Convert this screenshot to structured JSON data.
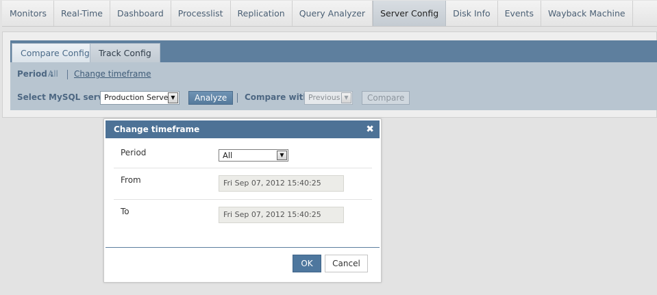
{
  "topnav": {
    "items": [
      "Monitors",
      "Real-Time",
      "Dashboard",
      "Processlist",
      "Replication",
      "Query Analyzer",
      "Server Config",
      "Disk Info",
      "Events",
      "Wayback Machine"
    ],
    "active": "Server Config"
  },
  "subtabs": {
    "compare": "Compare Config",
    "track": "Track Config",
    "active": "Track Config"
  },
  "toolbar": {
    "period_label": "Period :",
    "period_value": "All",
    "change_link": "Change timeframe",
    "select_label": "Select MySQL server",
    "server_value": "Production Server",
    "analyze": "Analyze",
    "compare_with_label": "Compare with",
    "compare_value": "Previous",
    "compare_button": "Compare"
  },
  "dialog": {
    "title": "Change timeframe",
    "period_label": "Period",
    "period_value": "All",
    "from_label": "From",
    "from_value": "Fri Sep 07, 2012 15:40:25",
    "to_label": "To",
    "to_value": "Fri Sep 07, 2012 15:40:25",
    "ok": "OK",
    "cancel": "Cancel"
  },
  "colors": {
    "accent": "#4d7296",
    "subtab_bar": "#5e7f9e",
    "toolbar_bg": "#b8c5d0"
  }
}
